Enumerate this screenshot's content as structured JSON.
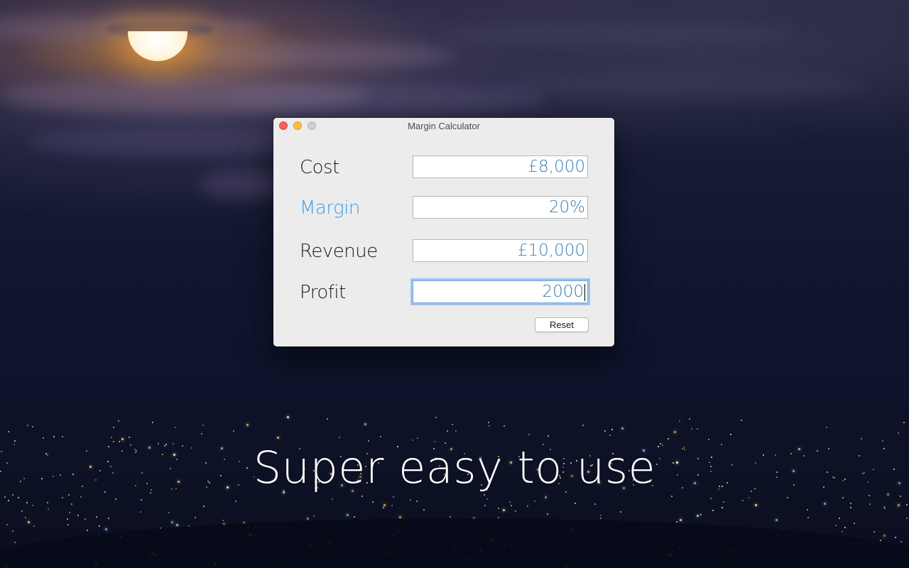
{
  "window": {
    "title": "Margin Calculator"
  },
  "fields": [
    {
      "label": "Cost",
      "value": "£8,000"
    },
    {
      "label": "Margin",
      "value": "20%"
    },
    {
      "label": "Revenue",
      "value": "£10,000"
    },
    {
      "label": "Profit",
      "value": "2000"
    }
  ],
  "buttons": {
    "reset_label": "Reset"
  },
  "tagline": "Super easy to use",
  "colors": {
    "accent_label": "#3a9ee8",
    "value_text": "#3d7fb0",
    "focus_ring": "#6ea9e6",
    "close": "#fc605c",
    "minimize": "#fdbc40",
    "zoom_disabled": "#cfcfcf"
  }
}
